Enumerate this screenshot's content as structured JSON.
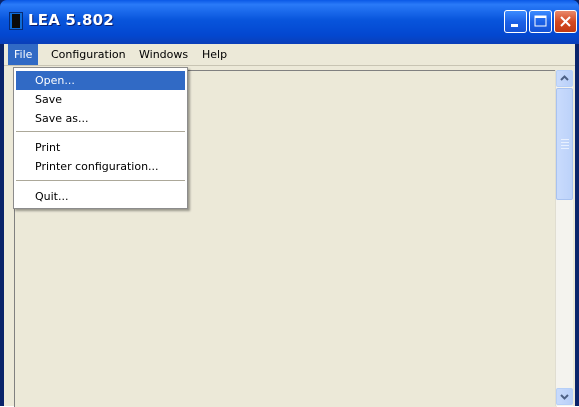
{
  "window": {
    "title": "LEA 5.802"
  },
  "menubar": {
    "items": [
      "File",
      "Configuration",
      "Windows",
      "Help"
    ]
  },
  "file_menu": {
    "items": [
      "Open...",
      "Save",
      "Save as...",
      "Print",
      "Printer configuration...",
      "Quit..."
    ],
    "highlighted": "Open..."
  },
  "colors": {
    "titlebar": "#0855dc",
    "menu_highlight": "#316ac5",
    "client_background": "#ece9d8"
  }
}
